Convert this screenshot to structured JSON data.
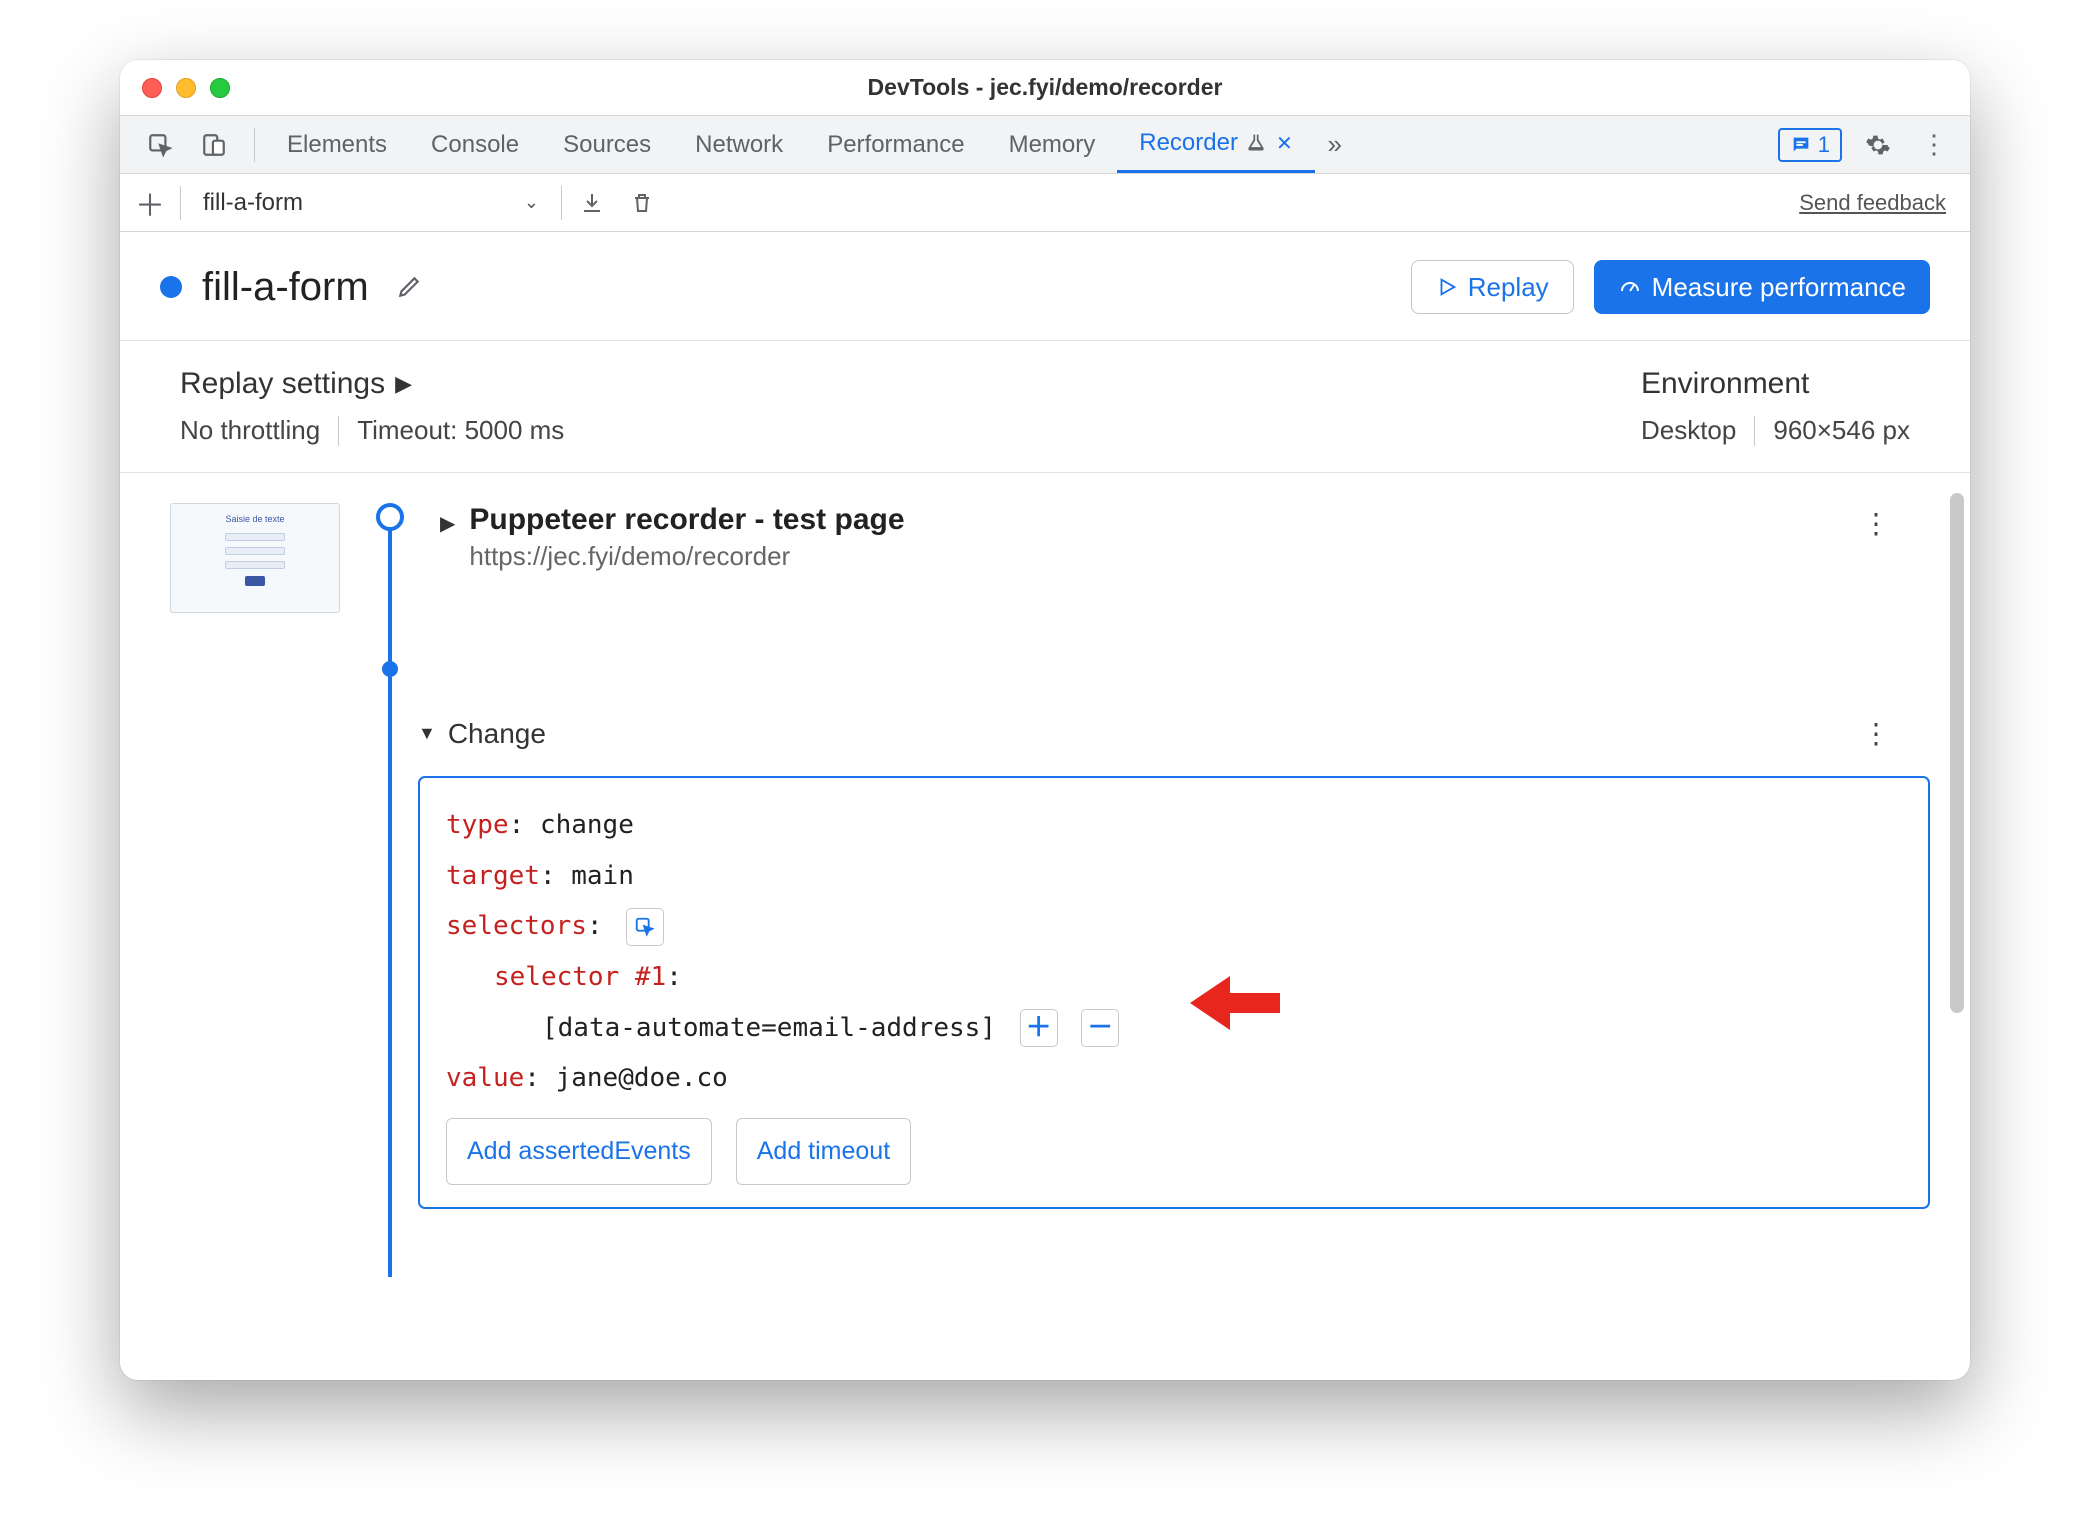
{
  "window": {
    "title": "DevTools - jec.fyi/demo/recorder"
  },
  "tabs": {
    "items": [
      "Elements",
      "Console",
      "Sources",
      "Network",
      "Performance",
      "Memory",
      "Recorder"
    ],
    "active": "Recorder",
    "issues_count": "1"
  },
  "toolbar": {
    "recording_name": "fill-a-form",
    "feedback": "Send feedback"
  },
  "header": {
    "title": "fill-a-form",
    "replay": "Replay",
    "measure": "Measure performance"
  },
  "settings": {
    "replay_title": "Replay settings",
    "throttling": "No throttling",
    "timeout": "Timeout: 5000 ms",
    "env_title": "Environment",
    "device": "Desktop",
    "viewport": "960×546 px"
  },
  "steps": {
    "start": {
      "title": "Puppeteer recorder - test page",
      "url": "https://jec.fyi/demo/recorder"
    },
    "change": {
      "label": "Change",
      "type_key": "type",
      "type_val": "change",
      "target_key": "target",
      "target_val": "main",
      "selectors_key": "selectors",
      "selector_num": "selector #1",
      "selector_val": "[data-automate=email-address]",
      "value_key": "value",
      "value_val": "jane@doe.co",
      "add_asserted": "Add assertedEvents",
      "add_timeout": "Add timeout"
    }
  }
}
